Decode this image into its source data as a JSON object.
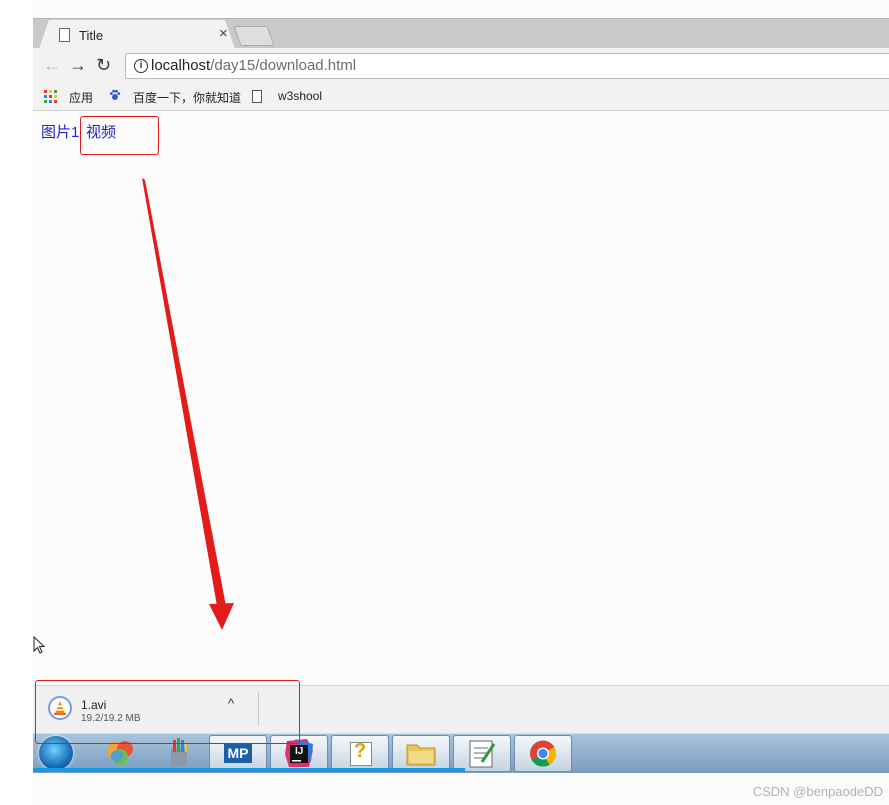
{
  "browser": {
    "tab_title": "Title",
    "close_glyph": "×",
    "url_host": "localhost",
    "url_path": "/day15/download.html",
    "back_glyph": "←",
    "forward_glyph": "→",
    "reload_glyph": "↻",
    "info_glyph": "i"
  },
  "bookmarks": {
    "apps_label": "应用",
    "baidu_label": "百度一下，你就知道",
    "w3school_label": "w3shool"
  },
  "page": {
    "link_image": "图片1",
    "link_video": "视频"
  },
  "download": {
    "file_name": "1.avi",
    "file_size": "19.2/19.2 MB",
    "chevron_glyph": "^"
  },
  "taskbar": {
    "mp_label": "MP",
    "ij_label": "IJ",
    "help_label": "?"
  },
  "watermark": "CSDN @benpaodeDD",
  "colors": {
    "annotation": "#e41b1b",
    "link": "#2222cc",
    "taskbar_accent": "#1a96e6"
  },
  "icons": [
    "doc-icon",
    "close-icon",
    "new-tab-icon",
    "back-icon",
    "forward-icon",
    "reload-icon",
    "info-icon",
    "apps-icon",
    "paw-icon",
    "vlc-icon",
    "chevron-up-icon",
    "start-orb-icon",
    "chrome-icon",
    "folder-icon",
    "notepad-icon",
    "paint-icon",
    "cursor-icon"
  ]
}
